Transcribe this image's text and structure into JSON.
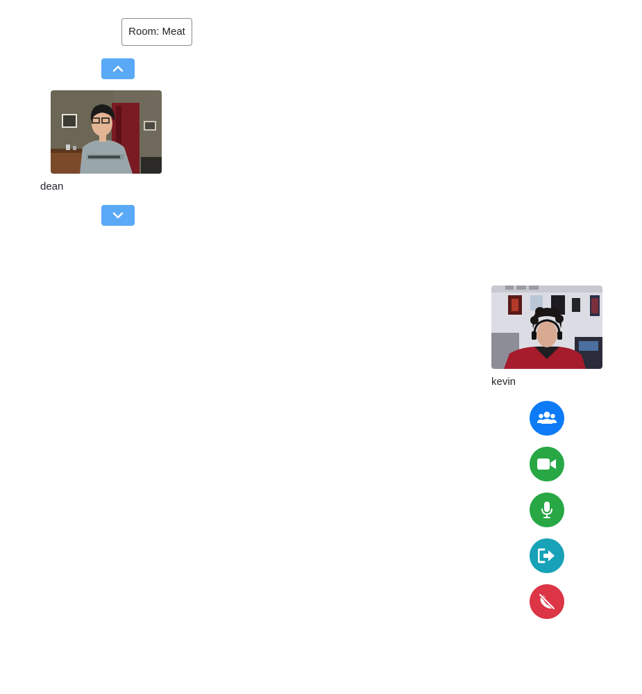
{
  "room": {
    "label": "Room: Meat"
  },
  "participants": [
    {
      "name": "dean"
    },
    {
      "name": "kevin"
    }
  ],
  "controls": [
    {
      "icon": "users-icon",
      "color": "#0d7bf6"
    },
    {
      "icon": "video-camera-icon",
      "color": "#28a745"
    },
    {
      "icon": "microphone-icon",
      "color": "#28a745"
    },
    {
      "icon": "sign-out-icon",
      "color": "#17a2b8"
    },
    {
      "icon": "phone-slash-icon",
      "color": "#dc3545"
    }
  ],
  "colors": {
    "scroll_button": "#5aa9f6",
    "text": "#212529"
  }
}
